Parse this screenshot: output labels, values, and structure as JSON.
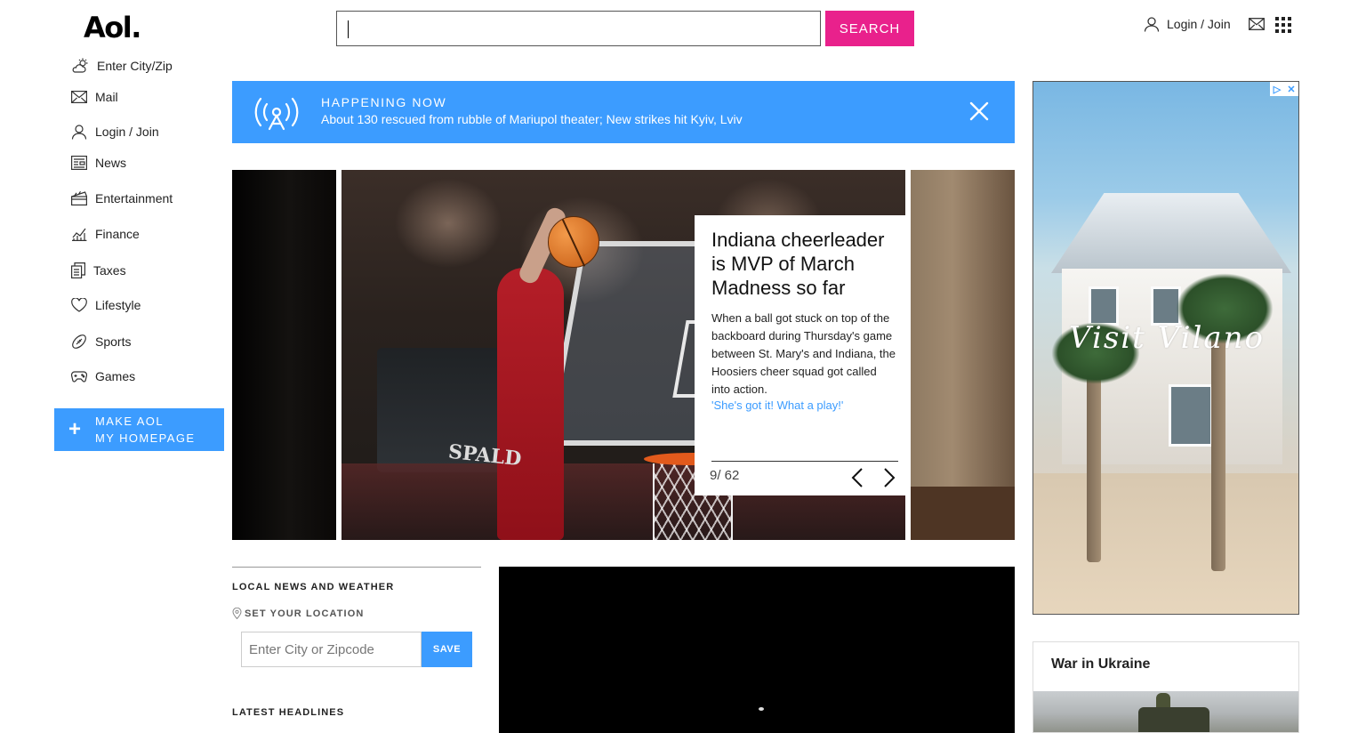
{
  "header": {
    "logo": "Aol.",
    "search_placeholder": "",
    "search_button": "SEARCH",
    "login_label": "Login / Join"
  },
  "sidebar": {
    "items": [
      {
        "label": "Enter City/Zip",
        "icon": "weather-icon"
      },
      {
        "label": "Mail",
        "icon": "mail-icon"
      },
      {
        "label": "Login / Join",
        "icon": "user-icon"
      },
      {
        "label": "News",
        "icon": "news-icon"
      },
      {
        "label": "Entertainment",
        "icon": "clapperboard-icon"
      },
      {
        "label": "Finance",
        "icon": "chart-icon"
      },
      {
        "label": "Taxes",
        "icon": "documents-icon"
      },
      {
        "label": "Lifestyle",
        "icon": "heart-icon"
      },
      {
        "label": "Sports",
        "icon": "football-icon"
      },
      {
        "label": "Games",
        "icon": "gamepad-icon"
      }
    ],
    "make_homepage_line1": "MAKE AOL",
    "make_homepage_line2": "MY HOMEPAGE"
  },
  "banner": {
    "tag": "HAPPENING NOW",
    "headline": "About 130 rescued from rubble of Mariupol theater; New strikes hit Kyiv, Lviv"
  },
  "carousel": {
    "title": "Indiana cheerleader is MVP of March Madness so far",
    "description": "When a ball got stuck on top of the backboard during Thursday's game between St. Mary's and Indiana, the Hoosiers cheer squad got called into action.",
    "link": "'She's got it! What a play!'",
    "counter": "9/ 62",
    "image_text": "SPALD"
  },
  "local": {
    "heading": "LOCAL NEWS AND WEATHER",
    "set_location": "SET YOUR LOCATION",
    "zip_placeholder": "Enter City or Zipcode",
    "save_label": "SAVE",
    "latest_headlines": "LATEST HEADLINES"
  },
  "ad": {
    "overlay_text": "Visit Vilano"
  },
  "war": {
    "title": "War in Ukraine"
  },
  "colors": {
    "accent_blue": "#3c9cff",
    "search_pink": "#e9218c"
  }
}
